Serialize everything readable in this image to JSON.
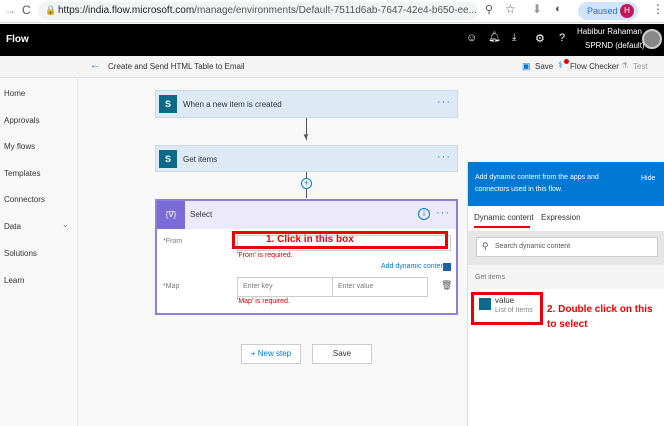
{
  "browser": {
    "url_host": "https://india.flow.microsoft.com",
    "url_path": "/manage/environments/Default-7511d6ab-7647-42e4-b650-ee...",
    "paused": "Paused",
    "profile": "H"
  },
  "app": {
    "title": "Flow",
    "user_name": "Habibur Rahaman",
    "environment": "SPRND (default)"
  },
  "subheader": {
    "flow_name": "Create and Send HTML Table to Email",
    "save": "Save",
    "flow_checker": "Flow Checker",
    "test": "Test"
  },
  "sidebar": {
    "items": [
      "Home",
      "Approvals",
      "My flows",
      "Templates",
      "Connectors",
      "Data",
      "Solutions",
      "Learn"
    ]
  },
  "steps": [
    {
      "title": "When a new item is created",
      "icon": "S"
    },
    {
      "title": "Get items",
      "icon": "S"
    }
  ],
  "select": {
    "title": "Select",
    "icon": "{∇}",
    "from_label": "*From",
    "from_error": "'From' is required.",
    "add_dynamic": "Add dynamic content",
    "map_label": "*Map",
    "key_placeholder": "Enter key",
    "value_placeholder": "Enter value",
    "map_error": "'Map' is required."
  },
  "annotations": {
    "one": "1. Click in this box",
    "two": "2. Double click on this to select"
  },
  "buttons": {
    "new_step": "+ New step",
    "save": "Save"
  },
  "panel": {
    "header": "Add dynamic content from the apps and connectors used in this flow.",
    "hide": "Hide",
    "tab_dynamic": "Dynamic content",
    "tab_expression": "Expression",
    "search_placeholder": "Search dynamic content",
    "group": "Get items",
    "item_name": "value",
    "item_desc": "List of Items"
  }
}
